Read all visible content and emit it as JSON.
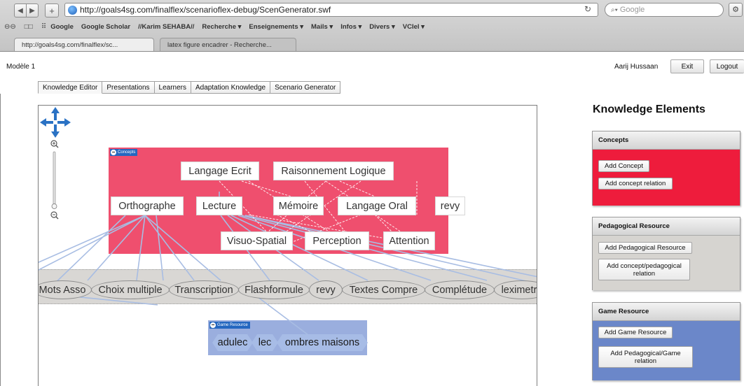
{
  "browser": {
    "url": "http://goals4sg.com/finalflex/scenarioflex-debug/ScenGenerator.swf",
    "search_placeholder": "Google",
    "back_icon": "back-arrow-icon",
    "forward_icon": "forward-arrow-icon",
    "add_icon": "plus-icon",
    "reload_icon": "reload-icon",
    "bookmarks": [
      "Google",
      "Google Scholar",
      "//Karim SEHABA//",
      "Recherche ▾",
      "Enseignements ▾",
      "Mails ▾",
      "Infos ▾",
      "Divers ▾",
      "VCIel ▾"
    ],
    "tabs": [
      {
        "label": "http://goals4sg.com/finalflex/sc..."
      },
      {
        "label": "latex figure encadrer - Recherche..."
      }
    ]
  },
  "app": {
    "model_title": "Modèle 1",
    "user_name": "Aarij Hussaan",
    "exit_label": "Exit",
    "logout_label": "Logout",
    "tabs": [
      {
        "label": "Knowledge Editor",
        "active": true
      },
      {
        "label": "Presentations",
        "active": false
      },
      {
        "label": "Learners",
        "active": false
      },
      {
        "label": "Adaptation Knowledge",
        "active": false
      },
      {
        "label": "Scenario Generator",
        "active": false
      }
    ]
  },
  "canvas": {
    "concepts_group_title": "Concepts",
    "game_group_title": "Game Resource",
    "concepts": [
      "Langage Ecrit",
      "Raisonnement Logique",
      "Orthographe",
      "Lecture",
      "Mémoire",
      "Langage  Oral",
      "revy",
      "Visuo-Spatial",
      "Perception",
      "Attention"
    ],
    "resources": [
      "Mots Asso",
      "Choix multiple",
      "Transcription",
      "Flashformule",
      "revy",
      "Textes Compre",
      "Complétude",
      "leximetre"
    ],
    "games": [
      "adulec",
      "lec",
      "ombres maisons"
    ]
  },
  "right_panel": {
    "title": "Knowledge Elements",
    "concepts": {
      "title": "Concepts",
      "add_concept": "Add Concept",
      "add_relation": "Add concept relation",
      "color": "#ee1c3c"
    },
    "pedagogical": {
      "title": "Pedagogical Resource",
      "add_resource": "Add Pedagogical Resource",
      "add_relation": "Add concept/pedagogical relation",
      "color": "#d6d4d0"
    },
    "game": {
      "title": "Game Resource",
      "add_resource": "Add Game Resource",
      "add_relation": "Add Pedagogical/Game relation",
      "color": "#6b87c9"
    }
  }
}
